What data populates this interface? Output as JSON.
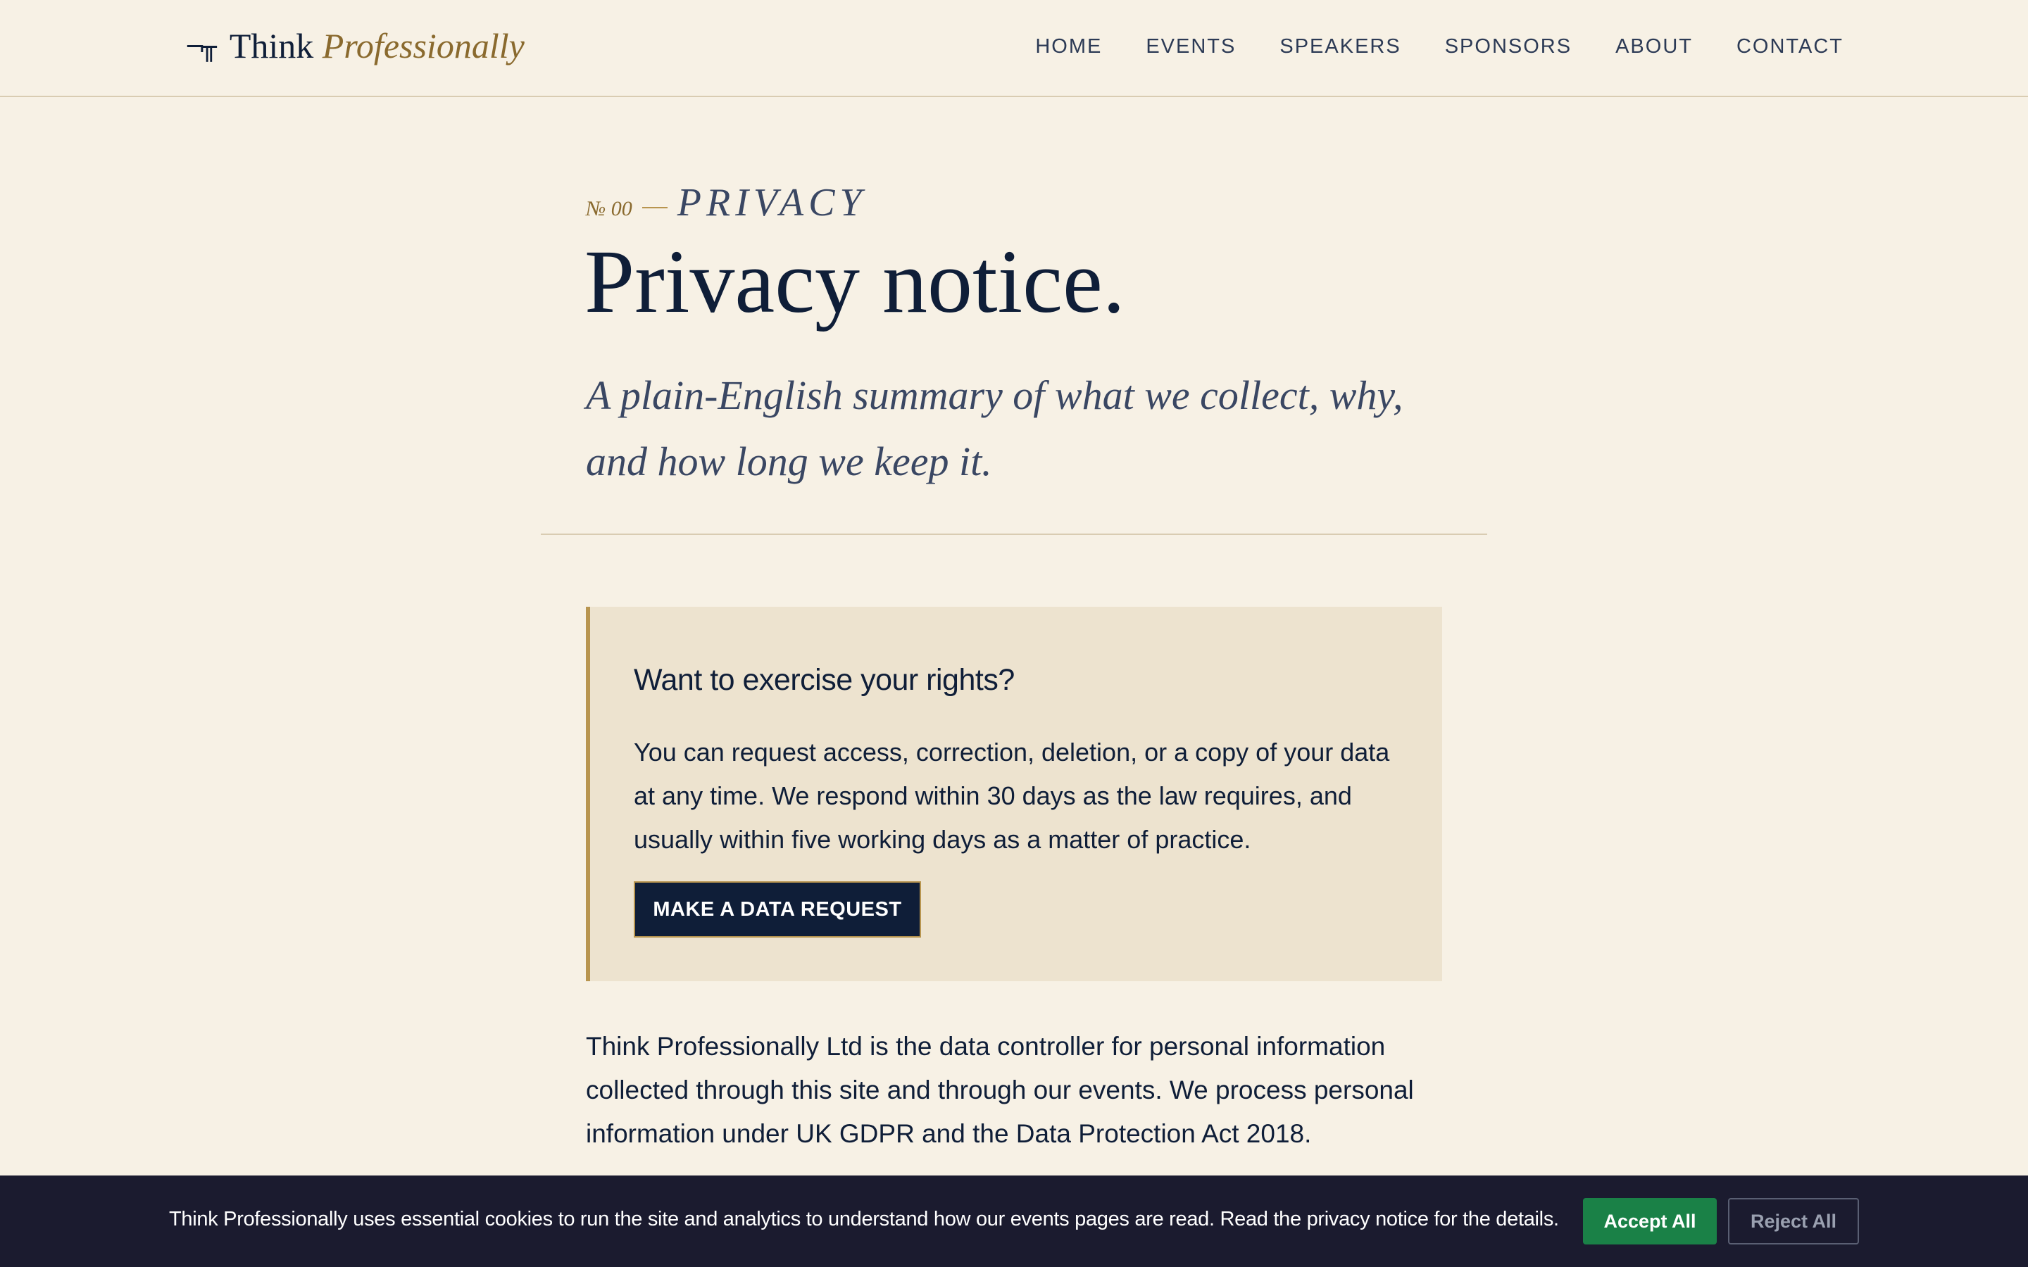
{
  "header": {
    "brand_mark": "¬╥",
    "brand_name": "Think",
    "brand_accent": "Professionally",
    "nav": [
      {
        "label": "HOME"
      },
      {
        "label": "EVENTS"
      },
      {
        "label": "SPEAKERS"
      },
      {
        "label": "SPONSORS"
      },
      {
        "label": "ABOUT"
      },
      {
        "label": "CONTACT"
      }
    ]
  },
  "hero": {
    "eyebrow_number": "№ 00",
    "eyebrow_label": "PRIVACY",
    "title": "Privacy notice.",
    "subtitle": "A plain-English summary of what we collect, why, and how long we keep it."
  },
  "callout": {
    "title": "Want to exercise your rights?",
    "body": "You can request access, correction, deletion, or a copy of your data at any time. We respond within 30 days as the law requires, and usually within five working days as a matter of practice.",
    "button_label": "MAKE A DATA REQUEST"
  },
  "content": {
    "paragraph": "Think Professionally Ltd is the data controller for personal information collected through this site and through our events. We process personal information under UK GDPR and the Data Protection Act 2018."
  },
  "cookie_banner": {
    "text": "Think Professionally uses essential cookies to run the site and analytics to understand how our events pages are read. Read the privacy notice for the details.",
    "accept_label": "Accept All",
    "reject_label": "Reject All"
  },
  "colors": {
    "background": "#f7f1e5",
    "navy": "#0f1e38",
    "gold": "#b8954f",
    "callout_bg": "#ede3cf",
    "banner_bg": "#1b1b2f",
    "accept_green": "#1a8147"
  }
}
